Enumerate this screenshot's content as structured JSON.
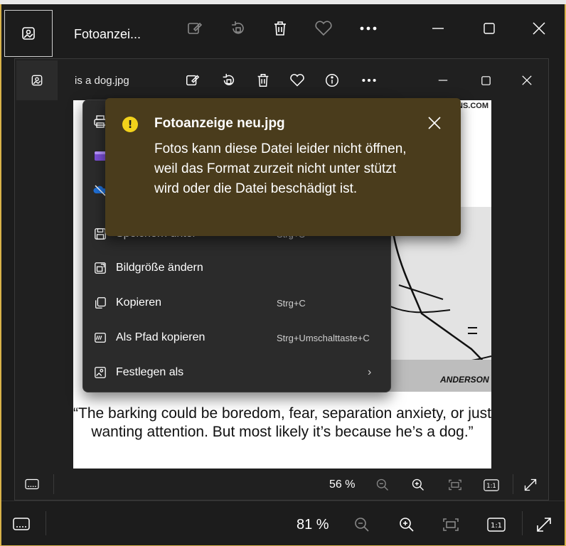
{
  "outer_window": {
    "title": "Fotoanzei...",
    "zoom": "81 %"
  },
  "inner_window": {
    "title": "is a dog.jpg",
    "zoom": "56 %"
  },
  "image": {
    "caption": "“The barking could be boredom, fear, separation anxiety, or just wanting attention. But most likely it’s because he’s a dog.”",
    "site_text": "NS.COM",
    "signature": "ANDERSON"
  },
  "context_menu": {
    "items": [
      {
        "label": "Speichern unter",
        "shortcut": "Strg+S",
        "icon": "save-icon"
      },
      {
        "label": "Bildgröße ändern",
        "shortcut": "",
        "icon": "resize-icon"
      },
      {
        "label": "Kopieren",
        "shortcut": "Strg+C",
        "icon": "copy-icon"
      },
      {
        "label": "Als Pfad kopieren",
        "shortcut": "Strg+Umschalttaste+C",
        "icon": "copy-path-icon"
      },
      {
        "label": "Festlegen als",
        "shortcut": "",
        "icon": "set-as-icon",
        "arrow": "›"
      }
    ]
  },
  "toast": {
    "title": "Fotoanzeige neu.jpg",
    "message": "Fotos kann diese Datei leider nicht öffnen, weil das Format zurzeit nicht unter stützt wird oder die Datei beschädigt ist.",
    "icon": "warning-icon",
    "color": "#4a3c1c",
    "accent": "#f2d21b"
  },
  "colors": {
    "window_border": "#d9b34a",
    "background": "#1c1c1c"
  }
}
